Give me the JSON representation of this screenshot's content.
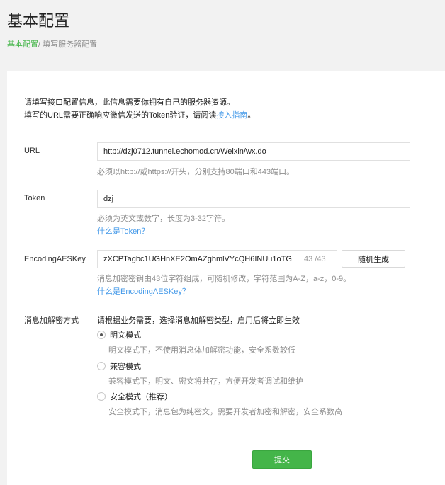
{
  "page": {
    "title": "基本配置",
    "breadcrumb": {
      "active": "基本配置",
      "separator": "/ ",
      "current": "填写服务器配置"
    }
  },
  "intro": {
    "line1": "请填写接口配置信息，此信息需要你拥有自己的服务器资源。",
    "line2_prefix": "填写的URL需要正确响应微信发送的Token验证，请阅读",
    "line2_link": "接入指南",
    "line2_suffix": "。"
  },
  "url_field": {
    "label": "URL",
    "value": "http://dzj0712.tunnel.echomod.cn/Weixin/wx.do",
    "hint": "必须以http://或https://开头，分别支持80端口和443端口。"
  },
  "token_field": {
    "label": "Token",
    "value": "dzj",
    "hint": "必须为英文或数字，长度为3-32字符。",
    "help": "什么是Token？"
  },
  "aes_field": {
    "label": "EncodingAESKey",
    "value": "zXCPTagbc1UGHnXE2OmAZghmlVYcQH6INUu1oTG",
    "count": "43",
    "max": "/43",
    "random_button": "随机生成",
    "hint": "消息加密密钥由43位字符组成，可随机修改，字符范围为A-Z，a-z，0-9。",
    "help": "什么是EncodingAESKey？"
  },
  "encrypt_field": {
    "label": "消息加解密方式",
    "instruction": "请根据业务需要，选择消息加解密类型，启用后将立即生效",
    "selected": "明文模式",
    "options": [
      {
        "label": "明文模式",
        "desc": "明文模式下，不使用消息体加解密功能，安全系数较低"
      },
      {
        "label": "兼容模式",
        "desc": "兼容模式下，明文、密文将共存，方便开发者调试和维护"
      },
      {
        "label": "安全模式（推荐）",
        "desc": "安全模式下，消息包为纯密文，需要开发者加密和解密，安全系数高"
      }
    ]
  },
  "submit_label": "提交",
  "colors": {
    "accent": "#44b549",
    "link": "#459ae9",
    "hint": "#8d8d8d"
  }
}
